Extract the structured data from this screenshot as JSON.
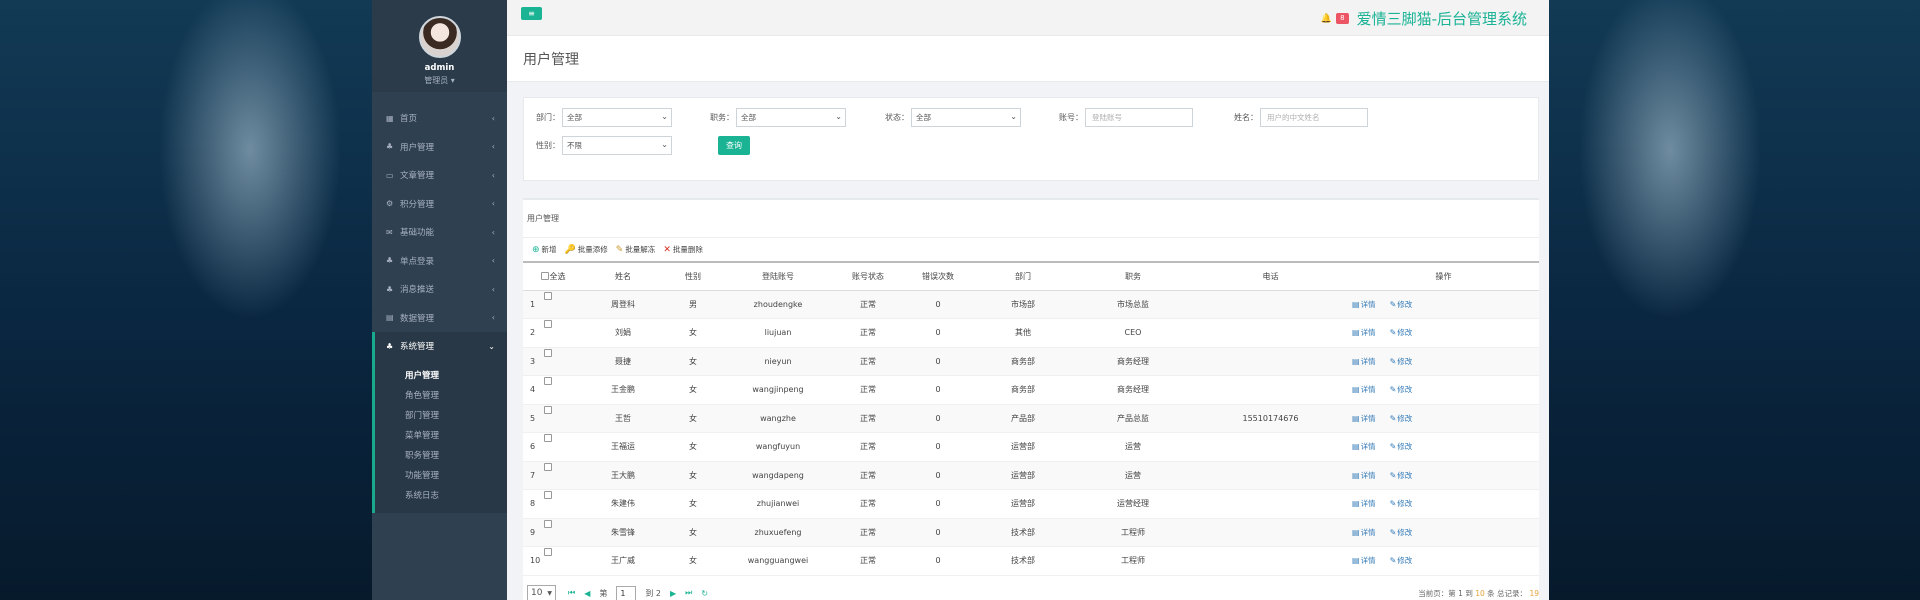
{
  "sidebar": {
    "user": {
      "name": "admin",
      "role": "管理员 ▾"
    },
    "menu": [
      {
        "label": "首页",
        "icon": "▦"
      },
      {
        "label": "用户管理",
        "icon": "♣"
      },
      {
        "label": "文章管理",
        "icon": "▭"
      },
      {
        "label": "积分管理",
        "icon": "⚙"
      },
      {
        "label": "基础功能",
        "icon": "✉"
      },
      {
        "label": "单点登录",
        "icon": "♣"
      },
      {
        "label": "消息推送",
        "icon": "♣"
      },
      {
        "label": "数据管理",
        "icon": "▤"
      },
      {
        "label": "系统管理",
        "icon": "♣"
      }
    ],
    "submenu": [
      "用户管理",
      "角色管理",
      "部门管理",
      "菜单管理",
      "职务管理",
      "功能管理",
      "系统日志"
    ]
  },
  "topbar": {
    "toggle_icon": "≡",
    "bell_icon": "🔔",
    "badge": "8",
    "brand": "爱情三脚猫-后台管理系统"
  },
  "page": {
    "title": "用户管理"
  },
  "filters": {
    "dept": {
      "label": "部门：",
      "value": "全部"
    },
    "post": {
      "label": "职务：",
      "value": "全部"
    },
    "status": {
      "label": "状态：",
      "value": "全部"
    },
    "account": {
      "label": "账号：",
      "placeholder": "登陆账号"
    },
    "name": {
      "label": "姓名：",
      "placeholder": "用户的中文姓名"
    },
    "gender": {
      "label": "性别：",
      "value": "不限"
    },
    "query": "查询"
  },
  "table_box": {
    "title": "用户管理",
    "toolbar": {
      "add": "新增",
      "reset_pwd": "批量添修",
      "unlock": "批量解冻",
      "delete": "批量删除"
    },
    "headers": {
      "select_all": "全选",
      "name": "姓名",
      "gender": "性别",
      "account": "登陆账号",
      "status": "账号状态",
      "errors": "错误次数",
      "dept": "部门",
      "post": "职务",
      "phone": "电话",
      "ops": "操作"
    },
    "ops": {
      "detail": "详情",
      "edit": "修改"
    },
    "rows": [
      {
        "idx": "1",
        "name": "周登科",
        "gender": "男",
        "account": "zhoudengke",
        "status": "正常",
        "errors": "0",
        "dept": "市场部",
        "post": "市场总监",
        "phone": ""
      },
      {
        "idx": "2",
        "name": "刘娟",
        "gender": "女",
        "account": "liujuan",
        "status": "正常",
        "errors": "0",
        "dept": "其他",
        "post": "CEO",
        "phone": ""
      },
      {
        "idx": "3",
        "name": "聂捷",
        "gender": "女",
        "account": "nieyun",
        "status": "正常",
        "errors": "0",
        "dept": "商务部",
        "post": "商务经理",
        "phone": ""
      },
      {
        "idx": "4",
        "name": "王金鹏",
        "gender": "女",
        "account": "wangjinpeng",
        "status": "正常",
        "errors": "0",
        "dept": "商务部",
        "post": "商务经理",
        "phone": ""
      },
      {
        "idx": "5",
        "name": "王哲",
        "gender": "女",
        "account": "wangzhe",
        "status": "正常",
        "errors": "0",
        "dept": "产品部",
        "post": "产品总监",
        "phone": "15510174676"
      },
      {
        "idx": "6",
        "name": "王福运",
        "gender": "女",
        "account": "wangfuyun",
        "status": "正常",
        "errors": "0",
        "dept": "运营部",
        "post": "运营",
        "phone": ""
      },
      {
        "idx": "7",
        "name": "王大鹏",
        "gender": "女",
        "account": "wangdapeng",
        "status": "正常",
        "errors": "0",
        "dept": "运营部",
        "post": "运营",
        "phone": ""
      },
      {
        "idx": "8",
        "name": "朱建伟",
        "gender": "女",
        "account": "zhujianwei",
        "status": "正常",
        "errors": "0",
        "dept": "运营部",
        "post": "运营经理",
        "phone": ""
      },
      {
        "idx": "9",
        "name": "朱雪锋",
        "gender": "女",
        "account": "zhuxuefeng",
        "status": "正常",
        "errors": "0",
        "dept": "技术部",
        "post": "工程师",
        "phone": ""
      },
      {
        "idx": "10",
        "name": "王广威",
        "gender": "女",
        "account": "wangguangwei",
        "status": "正常",
        "errors": "0",
        "dept": "技术部",
        "post": "工程师",
        "phone": ""
      }
    ]
  },
  "pager": {
    "size": "10",
    "prefix": "第",
    "page": "1",
    "suffix": "到 2",
    "info_prefix": "当前页：第 1 到",
    "info_hl": "10",
    "info_mid": "条 总记录：",
    "info_total": "19"
  }
}
